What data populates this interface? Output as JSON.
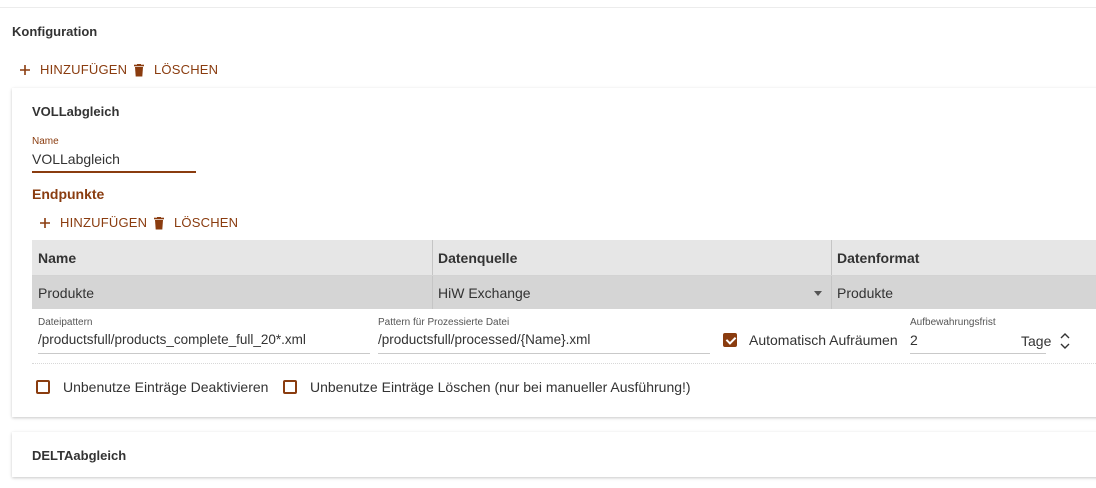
{
  "page": {
    "section_title": "Konfiguration"
  },
  "toolbar": {
    "add_label": "HINZUFÜGEN",
    "delete_label": "LÖSCHEN"
  },
  "config_card": {
    "title": "VOLLabgleich",
    "name_label": "Name",
    "name_value": "VOLLabgleich",
    "endpoints_title": "Endpunkte",
    "endpoints_add_label": "HINZUFÜGEN",
    "endpoints_delete_label": "LÖSCHEN",
    "table": {
      "columns": [
        "Name",
        "Datenquelle",
        "Datenformat"
      ],
      "rows": [
        {
          "name": "Produkte",
          "source": "HiW Exchange",
          "format": "Produkte"
        }
      ]
    },
    "detail": {
      "file_pattern_label": "Dateipattern",
      "file_pattern_value": "/productsfull/products_complete_full_20*.xml",
      "processed_pattern_label": "Pattern für Prozessierte Datei",
      "processed_pattern_value": "/productsfull/processed/{Name}.xml",
      "auto_cleanup_label": "Automatisch Aufräumen",
      "auto_cleanup_checked": true,
      "retention_label": "Aufbewahrungsfrist",
      "retention_value": "2",
      "retention_unit": "Tage"
    },
    "options": {
      "deactivate_unused_label": "Unbenutze Einträge Deaktivieren",
      "deactivate_unused_checked": false,
      "delete_unused_label": "Unbenutze Einträge Löschen (nur bei manueller Ausführung!)",
      "delete_unused_checked": false
    }
  },
  "delta_card": {
    "title": "DELTAabgleich"
  },
  "colors": {
    "accent": "#8a3c0f",
    "header_bg": "#e6e6e6",
    "row_bg": "#d5d5d5"
  },
  "icons": {
    "add": "plus-icon",
    "delete": "trash-icon",
    "dropdown": "caret-down-icon",
    "stepper": "chevron-up-down-icon"
  }
}
